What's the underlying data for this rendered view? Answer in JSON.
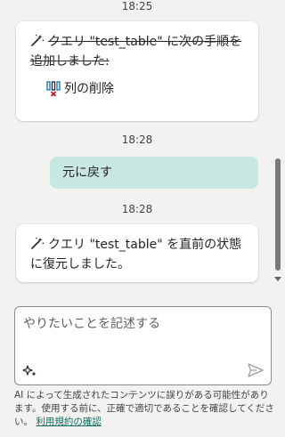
{
  "chat": {
    "timestamp_1": "18:25",
    "assistant_1": {
      "text": "クエリ \"test_table\" に次の手順を追加しました:",
      "step_label": "列の削除"
    },
    "timestamp_2": "18:28",
    "user_message": "元に戻す",
    "timestamp_3": "18:28",
    "assistant_2": {
      "text": "クエリ \"test_table\" を直前の状態に復元しました。"
    }
  },
  "composer": {
    "placeholder": "やりたいことを記述する",
    "value": ""
  },
  "footer": {
    "disclaimer": "AI によって生成されたコンテンツに誤りがある可能性があります。使用する前に、正確で適切であることを確認してください。",
    "terms_link": "利用規約の確認"
  },
  "colors": {
    "user_bubble": "#c6e8e1",
    "link": "#0f6e5a",
    "delete_step_icon_red": "#c50f1f",
    "delete_step_icon_blue": "#0f6cbd"
  },
  "icons": {
    "assistant_message": "magic-wand-icon",
    "step": "remove-column-icon",
    "composer_prompts": "sparkle-icon",
    "send": "send-icon"
  }
}
